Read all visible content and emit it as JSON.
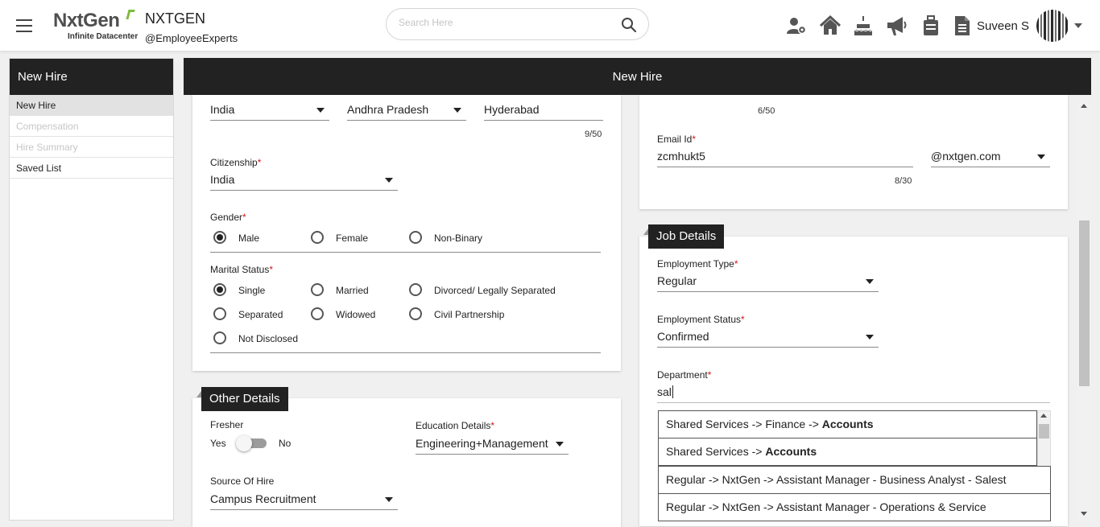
{
  "header": {
    "logo_text": "NxtGen",
    "logo_tagline": "Infinite Datacenter",
    "org_name": "NXTGEN",
    "org_handle": "@EmployeeExperts",
    "search_placeholder": "Search Here",
    "user_name": "Suveen S",
    "icons": [
      "team-settings-icon",
      "home-icon",
      "cake-icon",
      "megaphone-icon",
      "briefcase-icon",
      "document-icon"
    ]
  },
  "sidebar": {
    "title": "New Hire",
    "items": [
      {
        "label": "New Hire",
        "state": "active"
      },
      {
        "label": "Compensation",
        "state": "disabled"
      },
      {
        "label": "Hire Summary",
        "state": "disabled"
      },
      {
        "label": "Saved List",
        "state": "normal"
      }
    ]
  },
  "main": {
    "title": "New Hire"
  },
  "personal": {
    "country": "India",
    "state": "Andhra Pradesh",
    "city": "Hyderabad",
    "city_counter": "9/50",
    "citizenship_label": "Citizenship",
    "citizenship": "India",
    "gender_label": "Gender",
    "gender_options": [
      "Male",
      "Female",
      "Non-Binary"
    ],
    "gender_selected": "Male",
    "marital_label": "Marital Status",
    "marital_options": [
      "Single",
      "Married",
      "Divorced/ Legally Separated",
      "Separated",
      "Widowed",
      "Civil Partnership",
      "Not Disclosed"
    ],
    "marital_selected": "Single"
  },
  "other": {
    "section_title": "Other Details",
    "fresher_label": "Fresher",
    "fresher_yes": "Yes",
    "fresher_no": "No",
    "education_label": "Education Details",
    "education_value": "Engineering+Management",
    "source_label": "Source Of Hire",
    "source_value": "Campus Recruitment"
  },
  "contact": {
    "top_counter": "6/50",
    "email_label": "Email Id",
    "email_value": "zcmhukt5",
    "email_counter": "8/30",
    "email_domain": "@nxtgen.com"
  },
  "job": {
    "section_title": "Job Details",
    "employment_type_label": "Employment Type",
    "employment_type": "Regular",
    "employment_status_label": "Employment Status",
    "employment_status": "Confirmed",
    "department_label": "Department",
    "department_value": "sal",
    "suggestions": [
      {
        "prefix": "Shared Services -> Finance -> ",
        "match": "Accounts"
      },
      {
        "prefix": "Shared Services -> ",
        "match": "Accounts"
      },
      {
        "prefix": "Regular -> NxtGen -> Assistant Manager - Business Analyst - Salest",
        "match": ""
      },
      {
        "prefix": "Regular -> NxtGen -> Assistant Manager - Operations & Service",
        "match": ""
      }
    ]
  },
  "required_mark": "*"
}
